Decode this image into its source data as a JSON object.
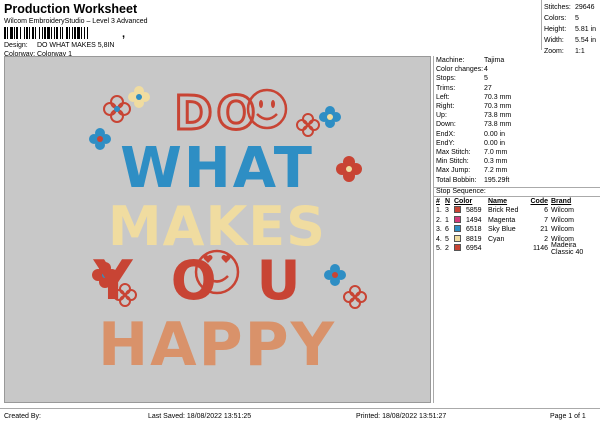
{
  "header": {
    "title": "Production Worksheet",
    "subtitle": "Wilcom EmbroideryStudio – Level 3 Advanced",
    "barcode_suffix": ",",
    "design_label": "Design:",
    "design_value": "DO WHAT MAKES 5,8IN",
    "colorway_label": "Colorway:",
    "colorway_value": "Colorway 1"
  },
  "stats": [
    {
      "label": "Stitches:",
      "value": "29646"
    },
    {
      "label": "Colors:",
      "value": "5"
    },
    {
      "label": "Height:",
      "value": "5.81 in"
    },
    {
      "label": "Width:",
      "value": "5.54 in"
    },
    {
      "label": "Zoom:",
      "value": "1:1"
    }
  ],
  "design_text": {
    "line1": "DO",
    "line2": "WHAT",
    "line3": "MAKES",
    "line4": "YOU",
    "line5": "HAPPY"
  },
  "colors": {
    "brick_red": "#c84434",
    "magenta": "#d23b7a",
    "sky_blue": "#2e8ec4",
    "cyan": "#f0dca0",
    "peach": "#d9926a",
    "canvas": "#c8c8c8"
  },
  "machine": [
    {
      "label": "Machine:",
      "value": "Tajima"
    },
    {
      "label": "Color changes:",
      "value": "4"
    },
    {
      "label": "Stops:",
      "value": "5"
    },
    {
      "label": "Trims:",
      "value": "27"
    },
    {
      "label": "Left:",
      "value": "70.3 mm"
    },
    {
      "label": "Right:",
      "value": "70.3 mm"
    },
    {
      "label": "Up:",
      "value": "73.8 mm"
    },
    {
      "label": "Down:",
      "value": "73.8 mm"
    },
    {
      "label": "EndX:",
      "value": "0.00 in"
    },
    {
      "label": "EndY:",
      "value": "0.00 in"
    },
    {
      "label": "Max Stitch:",
      "value": "7.0 mm"
    },
    {
      "label": "Min Stitch:",
      "value": "0.3 mm"
    },
    {
      "label": "Max Jump:",
      "value": "7.2 mm"
    },
    {
      "label": "Total Bobbin:",
      "value": "195.29ft"
    }
  ],
  "stop_sequence": {
    "title": "Stop Sequence:",
    "headers": [
      "#",
      "N",
      "Color",
      "Name",
      "Code",
      "Brand"
    ],
    "rows": [
      {
        "num": "1.",
        "n": "3",
        "color": "#c84434",
        "code_num": "5859",
        "name": "Brick Red",
        "code": "6",
        "brand": "Wilcom"
      },
      {
        "num": "2.",
        "n": "1",
        "color": "#d23b7a",
        "code_num": "1494",
        "name": "Magenta",
        "code": "7",
        "brand": "Wilcom"
      },
      {
        "num": "3.",
        "n": "6",
        "color": "#2e8ec4",
        "code_num": "6518",
        "name": "Sky Blue",
        "code": "21",
        "brand": "Wilcom"
      },
      {
        "num": "4.",
        "n": "5",
        "color": "#f0dca0",
        "code_num": "8819",
        "name": "Cyan",
        "code": "2",
        "brand": "Wilcom"
      },
      {
        "num": "5.",
        "n": "2",
        "color": "#c84434",
        "code_num": "6954",
        "name": "",
        "code": "1146",
        "brand": "Madeira Classic 40"
      }
    ]
  },
  "footer": {
    "created_by": "Created By:",
    "last_saved": "Last Saved: 18/08/2022 13:51:25",
    "printed": "Printed: 18/08/2022 13:51:27",
    "page": "Page 1 of 1"
  }
}
